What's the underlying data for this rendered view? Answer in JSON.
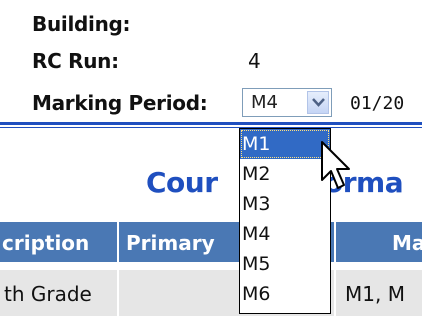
{
  "fields": {
    "building_label": "Building:",
    "rc_run_label": "RC Run:",
    "rc_run_value": "4",
    "marking_period_label": "Marking Period:",
    "marking_period_value": "M4",
    "date_partial": "01/20"
  },
  "dropdown": {
    "options": [
      "M1",
      "M2",
      "M3",
      "M4",
      "M5",
      "M6"
    ],
    "highlighted": "M1"
  },
  "section": {
    "title_left": "Cour",
    "title_right": "orma"
  },
  "table": {
    "headers": [
      "cription",
      "Primary",
      "Ma"
    ],
    "row": [
      "th Grade",
      "",
      "M1, M"
    ]
  },
  "colors": {
    "accent": "#1f4fbf",
    "header_bg": "#4a78b4",
    "row_bg": "#e6e6e6",
    "selection": "#316ac5"
  }
}
